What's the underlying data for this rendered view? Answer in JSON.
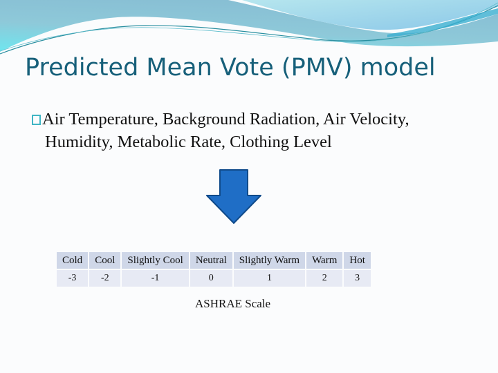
{
  "slide": {
    "title": "Predicted Mean Vote (PMV) model",
    "bullet": {
      "icon": "hollow-square-bullet-icon",
      "line1": "Air Temperature, Background Radiation, Air Velocity,",
      "line2": "Humidity, Metabolic Rate, Clothing Level"
    },
    "arrow_icon": "down-arrow-icon",
    "colors": {
      "title": "#17607a",
      "arrow_fill": "#1f6ec6",
      "arrow_stroke": "#0f4a8a",
      "header_cell": "#cfd7e8",
      "value_cell": "#e7eaf4",
      "bullet": "#3fb5c4"
    },
    "scale_table": {
      "labels": [
        "Cold",
        "Cool",
        "Slightly Cool",
        "Neutral",
        "Slightly Warm",
        "Warm",
        "Hot"
      ],
      "values": [
        "-3",
        "-2",
        "-1",
        "0",
        "1",
        "2",
        "3"
      ]
    },
    "caption": "ASHRAE Scale"
  }
}
